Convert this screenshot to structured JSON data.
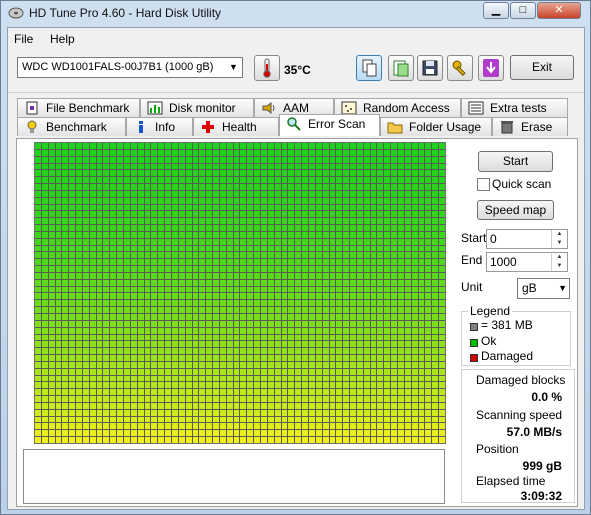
{
  "window": {
    "title": "HD Tune Pro 4.60 - Hard Disk Utility"
  },
  "menu": {
    "file": "File",
    "help": "Help"
  },
  "toolbar": {
    "drive": "WDC WD1001FALS-00J7B1 (1000 gB)",
    "temperature": "35°C",
    "exit_label": "Exit"
  },
  "tabs_top": [
    "File Benchmark",
    "Disk monitor",
    "AAM",
    "Random Access",
    "Extra tests"
  ],
  "tabs_bottom": [
    "Benchmark",
    "Info",
    "Health",
    "Error Scan",
    "Folder Usage",
    "Erase"
  ],
  "active_tab": "Error Scan",
  "controls": {
    "start_button": "Start",
    "quick_scan": "Quick scan",
    "speed_map_button": "Speed map",
    "start_label": "Start",
    "start_value": "0",
    "end_label": "End",
    "end_value": "1000",
    "unit_label": "Unit",
    "unit_value": "gB"
  },
  "legend": {
    "title": "Legend",
    "block_size": "= 381 MB",
    "ok": "Ok",
    "damaged": "Damaged",
    "colors": {
      "block": "#808080",
      "ok": "#00c000",
      "damaged": "#d00000"
    }
  },
  "stats": {
    "damaged_blocks_label": "Damaged blocks",
    "damaged_blocks_value": "0.0 %",
    "scanning_speed_label": "Scanning speed",
    "scanning_speed_value": "57.0 MB/s",
    "position_label": "Position",
    "position_value": "999 gB",
    "elapsed_label": "Elapsed time",
    "elapsed_value": "3:09:32"
  },
  "scan": {
    "top_color": "#1fd21a",
    "bottom_color": "#f0f01a",
    "status": "all blocks ok"
  }
}
